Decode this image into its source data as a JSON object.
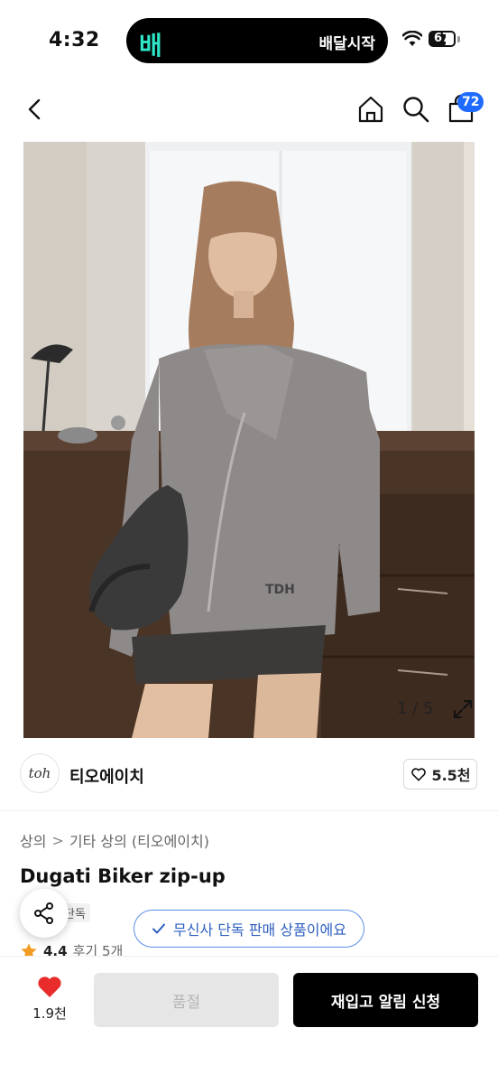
{
  "status": {
    "time": "4:32",
    "island_logo": "배",
    "island_text": "배달시작",
    "battery": "67",
    "battery_level": 0.67
  },
  "nav": {
    "cart_badge": "72",
    "icons": [
      "chevron-left-icon",
      "home-icon",
      "search-icon",
      "shopping-bag-icon"
    ]
  },
  "gallery": {
    "counter": "1 / 5"
  },
  "brand": {
    "logo_text": "toh",
    "name": "티오에이치",
    "likes": "5.5천"
  },
  "breadcrumb": {
    "items": [
      "상의",
      "기타 상의 (티오에이치)"
    ],
    "separator": ">"
  },
  "product": {
    "title": "Dugati Biker zip-up",
    "tag": "단독",
    "notice": "무신사 단독 판매 상품이에요",
    "rating": "4.4",
    "reviews": "후기 5개"
  },
  "bottom": {
    "wish_count": "1.9천",
    "soldout_label": "품절",
    "restock_label": "재입고 알림 신청"
  },
  "colors": {
    "accent_blue": "#1f6bff",
    "heart_red": "#e82c2c",
    "star_orange": "#f29b21"
  }
}
